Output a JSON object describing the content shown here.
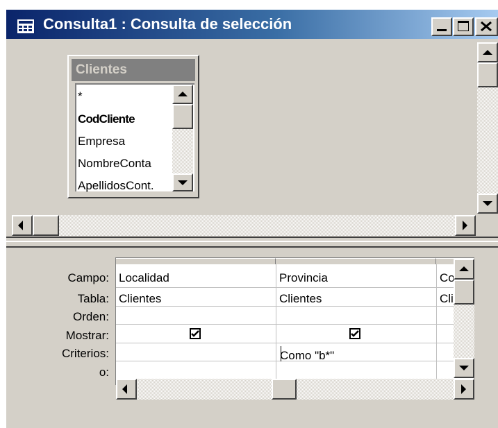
{
  "window": {
    "title": "Consulta1 : Consulta de selección",
    "buttons": [
      "minimize",
      "maximize",
      "close"
    ]
  },
  "field_list": {
    "table_name": "Clientes",
    "fields": [
      "*",
      "CodCliente",
      "Empresa",
      "NombreConta",
      "ApellidosCont."
    ],
    "primary_key": "CodCliente"
  },
  "grid": {
    "row_labels": [
      "Campo:",
      "Tabla:",
      "Orden:",
      "Mostrar:",
      "Criterios:",
      "o:"
    ],
    "columns": [
      {
        "campo": "Localidad",
        "tabla": "Clientes",
        "orden": "",
        "mostrar": true,
        "criterios": "",
        "o": ""
      },
      {
        "campo": "Provincia",
        "tabla": "Clientes",
        "orden": "",
        "mostrar": true,
        "criterios": "Como \"b*\"",
        "o": ""
      },
      {
        "campo": "CodF",
        "tabla": "Clien",
        "orden": "",
        "mostrar": true,
        "criterios": "",
        "o": ""
      }
    ]
  },
  "colors": {
    "titlebar_start": "#0a246a",
    "titlebar_end": "#a6caf0",
    "face": "#d4d0c8",
    "field_list_title": "#808080"
  },
  "icons": {
    "app": "query-window-icon",
    "minimize": "minimize-icon",
    "maximize": "maximize-icon",
    "close": "close-icon",
    "checkmark": "checkmark-icon"
  }
}
